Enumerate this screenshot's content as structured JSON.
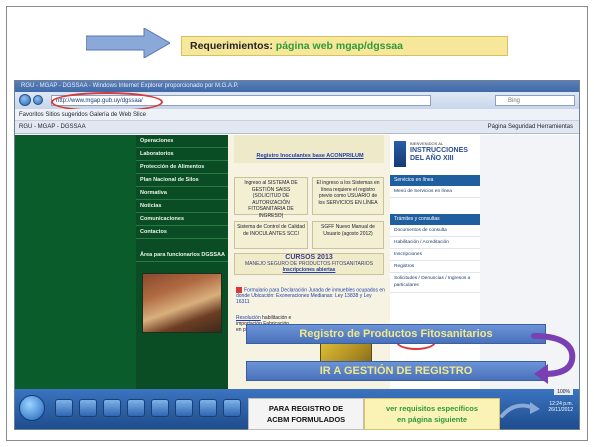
{
  "slide": {
    "title_prefix": "Requerimientos:",
    "title_highlight": "página web mgap/dgssaa"
  },
  "browser": {
    "window_title": "RGU - MGAP - DGSSAA - Windows Internet Explorer proporcionado por M.G.A.P.",
    "address": "http://www.mgap.gub.uy/dgssaa/",
    "search_placeholder": "Bing",
    "favorites_bar": "Favoritos   Sitios sugeridos   Galería de Web Slice",
    "tab_label": "RGU - MGAP - DGSSAA",
    "tools": "Página   Seguridad   Herramientas",
    "nav_items": [
      "Operaciones",
      "Laboratorios",
      "Protección de Alimentos",
      "Plan Nacional de Silos",
      "Normativa",
      "Noticias",
      "Comunicaciones",
      "Contactos",
      "Área para funcionarios DGSSAA"
    ],
    "center": {
      "link_top": "Registro Inoculantes base ACONPRILUM",
      "box_a": "Ingreso al SISTEMA DE GESTIÓN SAISS (SOLICITUD DE AUTORIZACIÓN FITOSANITARIA DE INGRESO)",
      "box_b": "El ingreso a los Sistemas en línea requiere el registro previo como USUARIO de los SERVICIOS EN LÍNEA",
      "box_c": "Sistema de Control de Calidad de INOCULANTES SCCI",
      "box_d": "SGFF Nuevo Manual de Usuario (agosto 2012)",
      "cursos_title": "CURSOS 2013",
      "cursos_sub": "MANEJO SEGURO DE PRODUCTOS FITOSANITARIOS",
      "cursos_link": "Inscripciones abiertas",
      "form_text": "Formulario para Declaración Jurada de inmuebles ocupados en donde Ubicación: Exoneraciones Medianas: Ley 13838 y Ley 16311",
      "resol_link": "Resolución",
      "resol_text": "habilitación e importación Fabricación en para animales"
    },
    "right": {
      "logo_small": "BIENVENIDOS AL",
      "logo_big_1": "INSTRUCCIONES",
      "logo_big_2": "DEL AÑO XIII",
      "head_1": "Servicios en línea",
      "item_1": "Menú de Servicios en línea",
      "head_2": "Trámites y consultas",
      "items": [
        "Documentos de consulta",
        "Habilitación / Acreditación",
        "Inscripciones",
        "Registros",
        "Solicitudes / Denuncias / Ingresos a particulares"
      ]
    },
    "zoom": "100%",
    "clock_time": "12:24 p.m.",
    "clock_date": "26/11/2012"
  },
  "overlay": {
    "banner_registro": "Registro de Productos Fitosanitarios",
    "banner_ir": "IR A GESTIÓN DE REGISTRO",
    "box_acbm_line1": "PARA REGISTRO DE",
    "box_acbm_line2": "ACBM FORMULADOS",
    "box_req_line1": "ver requisitos específicos",
    "box_req_line2": "en página siguiente"
  }
}
